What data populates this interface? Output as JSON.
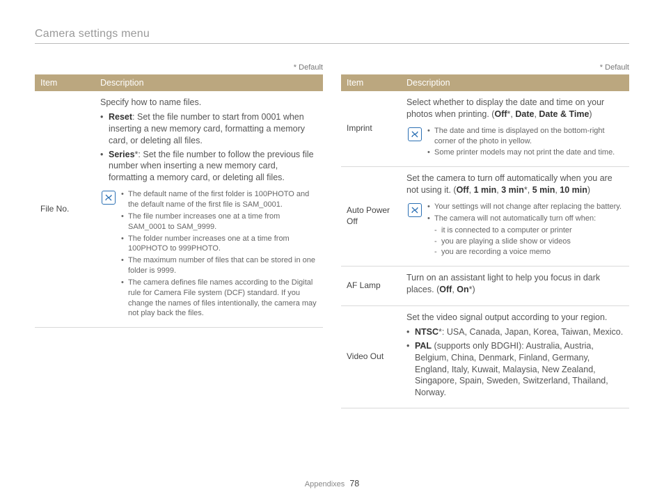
{
  "page_title": "Camera settings menu",
  "default_note": "* Default",
  "headers": {
    "item": "Item",
    "description": "Description"
  },
  "left": {
    "file_no": {
      "label": "File No.",
      "intro": "Specify how to name files.",
      "b1_bold": "Reset",
      "b1_rest": ": Set the file number to start from 0001 when inserting a new memory card, formatting a memory card, or deleting all files.",
      "b2_bold": "Series",
      "b2_star": "*",
      "b2_rest": ": Set the file number to follow the previous file number when inserting a new memory card, formatting a memory card, or deleting all files.",
      "notes": {
        "n1": "The default name of the first folder is 100PHOTO and the default name of the first file is SAM_0001.",
        "n2": "The file number increases one at a time from SAM_0001 to SAM_9999.",
        "n3": "The folder number increases one at a time from 100PHOTO to 999PHOTO.",
        "n4": "The maximum number of files that can be stored in one folder is 9999.",
        "n5": "The camera defines file names according to the Digital rule for Camera File system (DCF) standard. If you change the names of files intentionally, the camera may not play back the files."
      }
    }
  },
  "right": {
    "imprint": {
      "label": "Imprint",
      "p_pre": "Select whether to display the date and time on your photos when printing. (",
      "o1": "Off",
      "o1_star": "*",
      "sep": ", ",
      "o2": "Date",
      "o3": "Date & Time",
      "p_post": ")",
      "notes": {
        "n1": "The date and time is displayed on the bottom-right corner of the photo in yellow.",
        "n2": "Some printer models may not print the date and time."
      }
    },
    "auto_power_off": {
      "label": "Auto Power Off",
      "p_pre": "Set the camera to turn off automatically when you are not using it. (",
      "o1": "Off",
      "o2": "1 min",
      "o3": "3 min",
      "o3_star": "*",
      "o4": "5 min",
      "o5": "10 min",
      "p_post": ")",
      "notes": {
        "n1": "Your settings will not change after replacing the battery.",
        "n2": "The camera will not automatically turn off when:",
        "s1": "it is connected to a computer or printer",
        "s2": "you are playing a slide show or videos",
        "s3": "you are recording a voice memo"
      }
    },
    "af_lamp": {
      "label": "AF Lamp",
      "p_pre": "Turn on an assistant light to help you focus in dark places. (",
      "o1": "Off",
      "o2": "On",
      "o2_star": "*",
      "p_post": ")"
    },
    "video_out": {
      "label": "Video Out",
      "intro": "Set the video signal output according to your region.",
      "b1_bold": "NTSC",
      "b1_star": "*",
      "b1_rest": ": USA, Canada, Japan, Korea, Taiwan, Mexico.",
      "b2_bold": "PAL",
      "b2_rest": " (supports only BDGHI): Australia, Austria, Belgium, China, Denmark, Finland, Germany, England, Italy, Kuwait, Malaysia, New Zealand, Singapore, Spain, Sweden, Switzerland, Thailand, Norway."
    }
  },
  "footer": {
    "section": "Appendixes",
    "page": "78"
  }
}
